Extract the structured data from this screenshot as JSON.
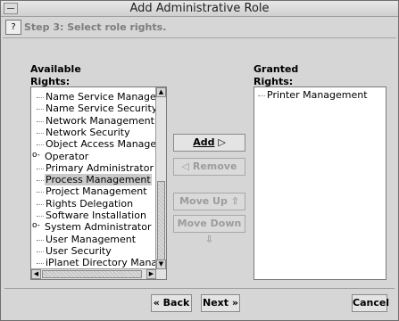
{
  "window": {
    "title": "Add Administrative Role"
  },
  "step": {
    "text": "Step 3: Select role rights."
  },
  "available": {
    "label_line1": "Available",
    "label_line2": "Rights:",
    "items": [
      {
        "label": "Name Service Management",
        "type": "leaf",
        "selected": false
      },
      {
        "label": "Name Service Security",
        "type": "leaf",
        "selected": false
      },
      {
        "label": "Network Management",
        "type": "leaf",
        "selected": false
      },
      {
        "label": "Network Security",
        "type": "leaf",
        "selected": false
      },
      {
        "label": "Object Access Management",
        "type": "leaf",
        "selected": false
      },
      {
        "label": "Operator",
        "type": "group",
        "selected": false
      },
      {
        "label": "Primary Administrator",
        "type": "leaf",
        "selected": false
      },
      {
        "label": "Process Management",
        "type": "leaf",
        "selected": true
      },
      {
        "label": "Project Management",
        "type": "leaf",
        "selected": false
      },
      {
        "label": "Rights Delegation",
        "type": "leaf",
        "selected": false
      },
      {
        "label": "Software Installation",
        "type": "leaf",
        "selected": false
      },
      {
        "label": "System Administrator",
        "type": "group",
        "selected": false
      },
      {
        "label": "User Management",
        "type": "leaf",
        "selected": false
      },
      {
        "label": "User Security",
        "type": "leaf",
        "selected": false
      },
      {
        "label": "iPlanet Directory Management",
        "type": "leaf",
        "selected": false
      }
    ]
  },
  "granted": {
    "label_line1": "Granted",
    "label_line2": "Rights:",
    "items": [
      "Printer Management"
    ]
  },
  "buttons": {
    "add": "Add",
    "remove": "Remove",
    "move_up": "Move Up",
    "move_down": "Move Down",
    "back": "Back",
    "next": "Next",
    "cancel": "Cancel"
  },
  "icons": {
    "add": "arrow-right-icon",
    "remove": "arrow-left-icon",
    "move_up": "arrow-up-icon",
    "move_down": "arrow-down-icon",
    "back": "double-chevron-left-icon",
    "next": "double-chevron-right-icon",
    "help": "help-icon",
    "group": "expand-node-icon"
  }
}
